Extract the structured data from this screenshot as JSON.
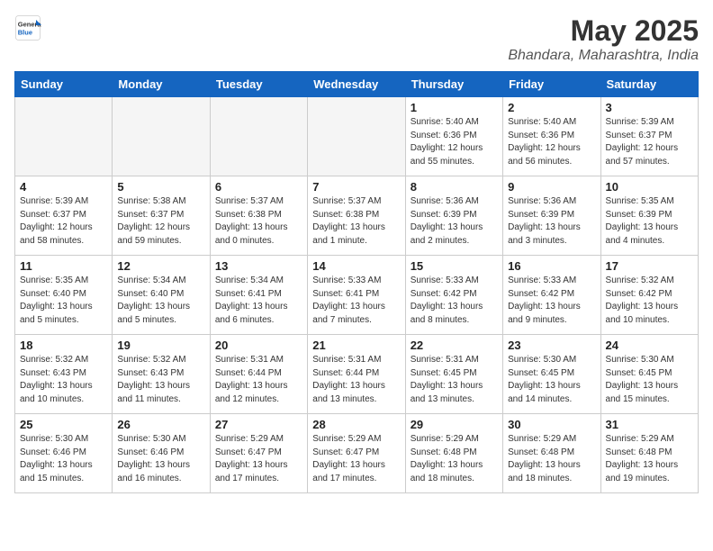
{
  "logo": {
    "general": "General",
    "blue": "Blue"
  },
  "title": "May 2025",
  "subtitle": "Bhandara, Maharashtra, India",
  "headers": [
    "Sunday",
    "Monday",
    "Tuesday",
    "Wednesday",
    "Thursday",
    "Friday",
    "Saturday"
  ],
  "weeks": [
    [
      {
        "day": "",
        "info": "",
        "empty": true
      },
      {
        "day": "",
        "info": "",
        "empty": true
      },
      {
        "day": "",
        "info": "",
        "empty": true
      },
      {
        "day": "",
        "info": "",
        "empty": true
      },
      {
        "day": "1",
        "info": "Sunrise: 5:40 AM\nSunset: 6:36 PM\nDaylight: 12 hours\nand 55 minutes."
      },
      {
        "day": "2",
        "info": "Sunrise: 5:40 AM\nSunset: 6:36 PM\nDaylight: 12 hours\nand 56 minutes."
      },
      {
        "day": "3",
        "info": "Sunrise: 5:39 AM\nSunset: 6:37 PM\nDaylight: 12 hours\nand 57 minutes."
      }
    ],
    [
      {
        "day": "4",
        "info": "Sunrise: 5:39 AM\nSunset: 6:37 PM\nDaylight: 12 hours\nand 58 minutes."
      },
      {
        "day": "5",
        "info": "Sunrise: 5:38 AM\nSunset: 6:37 PM\nDaylight: 12 hours\nand 59 minutes."
      },
      {
        "day": "6",
        "info": "Sunrise: 5:37 AM\nSunset: 6:38 PM\nDaylight: 13 hours\nand 0 minutes."
      },
      {
        "day": "7",
        "info": "Sunrise: 5:37 AM\nSunset: 6:38 PM\nDaylight: 13 hours\nand 1 minute."
      },
      {
        "day": "8",
        "info": "Sunrise: 5:36 AM\nSunset: 6:39 PM\nDaylight: 13 hours\nand 2 minutes."
      },
      {
        "day": "9",
        "info": "Sunrise: 5:36 AM\nSunset: 6:39 PM\nDaylight: 13 hours\nand 3 minutes."
      },
      {
        "day": "10",
        "info": "Sunrise: 5:35 AM\nSunset: 6:39 PM\nDaylight: 13 hours\nand 4 minutes."
      }
    ],
    [
      {
        "day": "11",
        "info": "Sunrise: 5:35 AM\nSunset: 6:40 PM\nDaylight: 13 hours\nand 5 minutes."
      },
      {
        "day": "12",
        "info": "Sunrise: 5:34 AM\nSunset: 6:40 PM\nDaylight: 13 hours\nand 5 minutes."
      },
      {
        "day": "13",
        "info": "Sunrise: 5:34 AM\nSunset: 6:41 PM\nDaylight: 13 hours\nand 6 minutes."
      },
      {
        "day": "14",
        "info": "Sunrise: 5:33 AM\nSunset: 6:41 PM\nDaylight: 13 hours\nand 7 minutes."
      },
      {
        "day": "15",
        "info": "Sunrise: 5:33 AM\nSunset: 6:42 PM\nDaylight: 13 hours\nand 8 minutes."
      },
      {
        "day": "16",
        "info": "Sunrise: 5:33 AM\nSunset: 6:42 PM\nDaylight: 13 hours\nand 9 minutes."
      },
      {
        "day": "17",
        "info": "Sunrise: 5:32 AM\nSunset: 6:42 PM\nDaylight: 13 hours\nand 10 minutes."
      }
    ],
    [
      {
        "day": "18",
        "info": "Sunrise: 5:32 AM\nSunset: 6:43 PM\nDaylight: 13 hours\nand 10 minutes."
      },
      {
        "day": "19",
        "info": "Sunrise: 5:32 AM\nSunset: 6:43 PM\nDaylight: 13 hours\nand 11 minutes."
      },
      {
        "day": "20",
        "info": "Sunrise: 5:31 AM\nSunset: 6:44 PM\nDaylight: 13 hours\nand 12 minutes."
      },
      {
        "day": "21",
        "info": "Sunrise: 5:31 AM\nSunset: 6:44 PM\nDaylight: 13 hours\nand 13 minutes."
      },
      {
        "day": "22",
        "info": "Sunrise: 5:31 AM\nSunset: 6:45 PM\nDaylight: 13 hours\nand 13 minutes."
      },
      {
        "day": "23",
        "info": "Sunrise: 5:30 AM\nSunset: 6:45 PM\nDaylight: 13 hours\nand 14 minutes."
      },
      {
        "day": "24",
        "info": "Sunrise: 5:30 AM\nSunset: 6:45 PM\nDaylight: 13 hours\nand 15 minutes."
      }
    ],
    [
      {
        "day": "25",
        "info": "Sunrise: 5:30 AM\nSunset: 6:46 PM\nDaylight: 13 hours\nand 15 minutes."
      },
      {
        "day": "26",
        "info": "Sunrise: 5:30 AM\nSunset: 6:46 PM\nDaylight: 13 hours\nand 16 minutes."
      },
      {
        "day": "27",
        "info": "Sunrise: 5:29 AM\nSunset: 6:47 PM\nDaylight: 13 hours\nand 17 minutes."
      },
      {
        "day": "28",
        "info": "Sunrise: 5:29 AM\nSunset: 6:47 PM\nDaylight: 13 hours\nand 17 minutes."
      },
      {
        "day": "29",
        "info": "Sunrise: 5:29 AM\nSunset: 6:48 PM\nDaylight: 13 hours\nand 18 minutes."
      },
      {
        "day": "30",
        "info": "Sunrise: 5:29 AM\nSunset: 6:48 PM\nDaylight: 13 hours\nand 18 minutes."
      },
      {
        "day": "31",
        "info": "Sunrise: 5:29 AM\nSunset: 6:48 PM\nDaylight: 13 hours\nand 19 minutes."
      }
    ]
  ]
}
